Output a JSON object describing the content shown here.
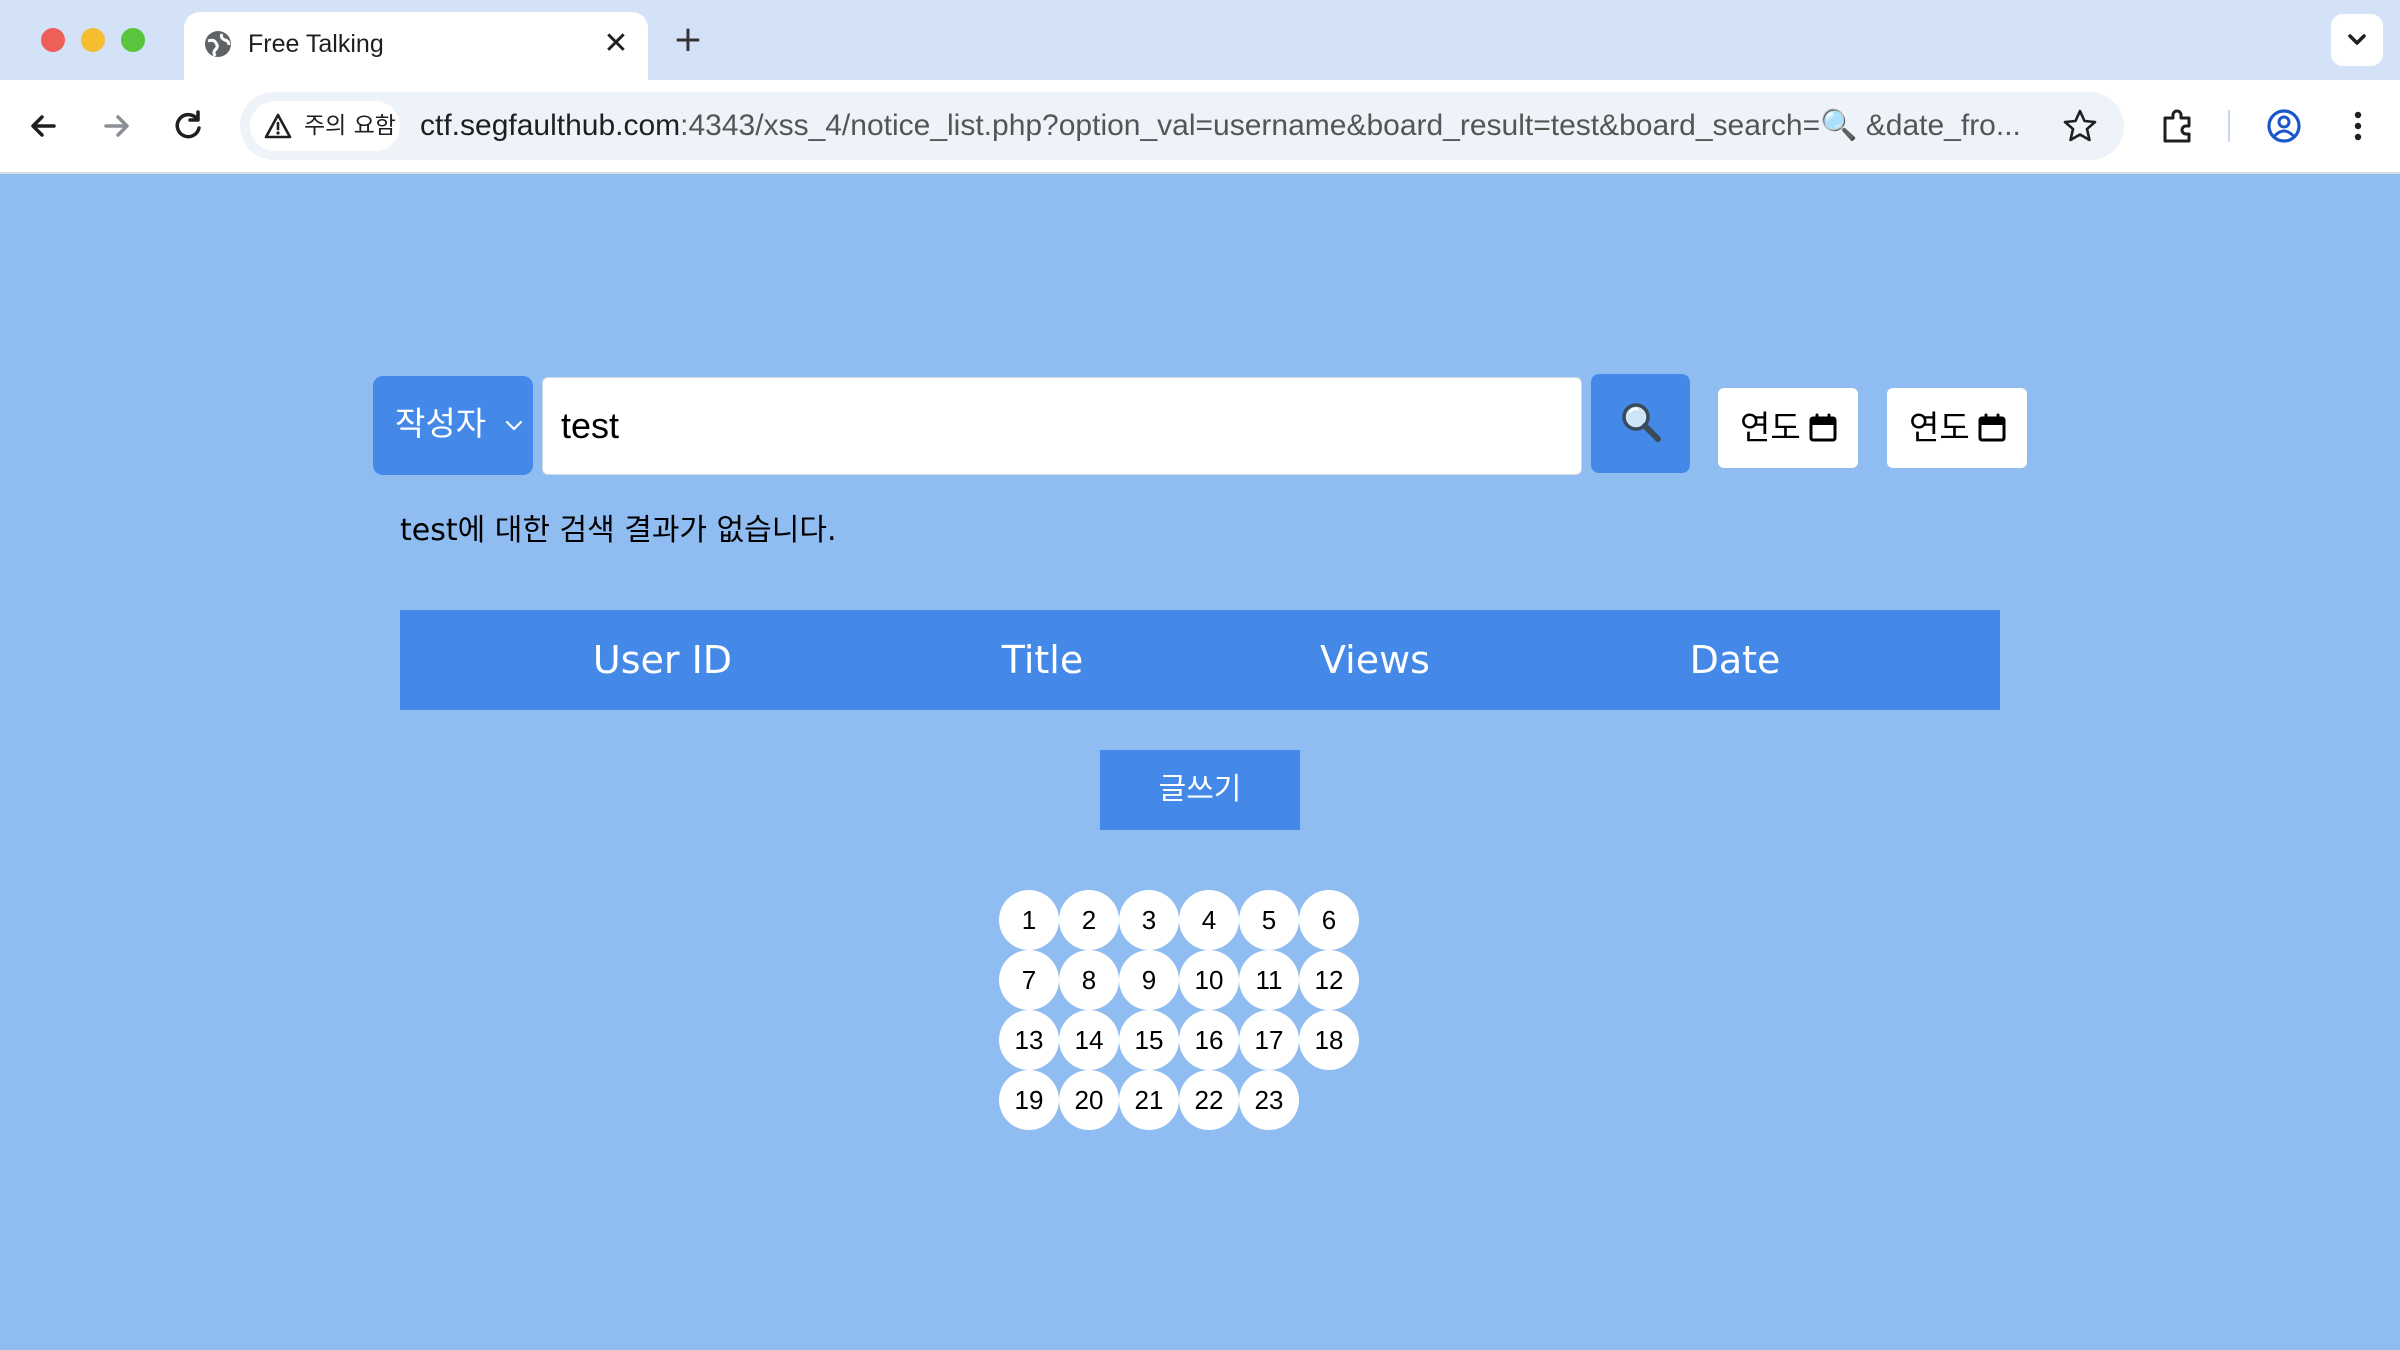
{
  "browser": {
    "tab_title": "Free Talking",
    "security_label": "주의 요함",
    "url_main": "ctf.segfaulthub.com",
    "url_rest": ":4343/xss_4/notice_list.php?option_val=username&board_result=test&board_search=🔍 &date_fro..."
  },
  "search": {
    "option_selected": "작성자",
    "query": "test",
    "date_from_label": "연도",
    "date_to_label": "연도"
  },
  "result_message": "test에 대한 검색 결과가 없습니다.",
  "table": {
    "columns": [
      "User ID",
      "Title",
      "Views",
      "Date"
    ],
    "rows": []
  },
  "write_button_label": "글쓰기",
  "pagination": {
    "pages": [
      "1",
      "2",
      "3",
      "4",
      "5",
      "6",
      "7",
      "8",
      "9",
      "10",
      "11",
      "12",
      "13",
      "14",
      "15",
      "16",
      "17",
      "18",
      "19",
      "20",
      "21",
      "22",
      "23"
    ]
  },
  "colors": {
    "page_background": "#8fbcf1",
    "accent": "#4489e8"
  }
}
